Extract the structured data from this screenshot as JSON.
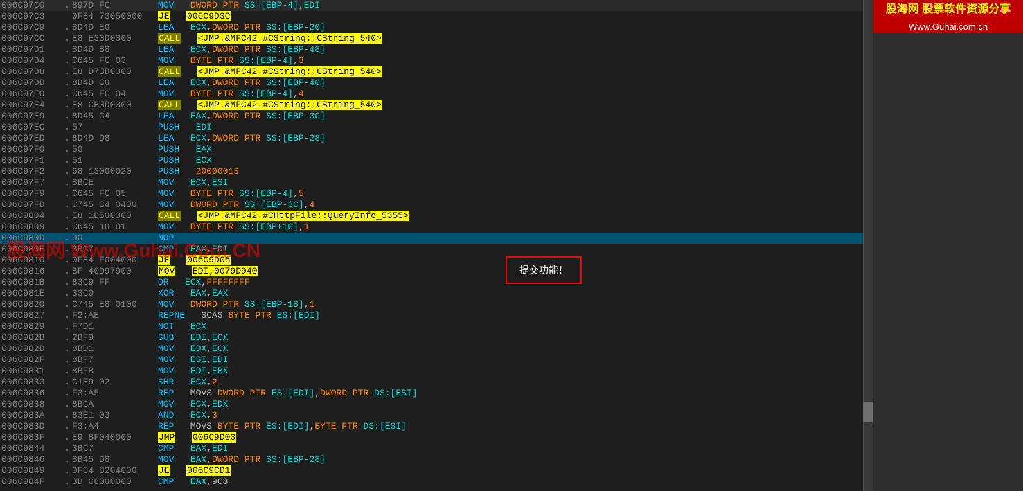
{
  "brand": {
    "name": "股海网 股票软件资源分享",
    "url": "Www.Guhai.com.cn"
  },
  "watermark": "股海网 Www.Guhai.Com.CN",
  "submit_box_text": "提交功能！",
  "rows": [
    {
      "address": "006C97C0",
      "dot": ".",
      "bytes": "897D FC",
      "mnemonic": "MOV",
      "operands": "DWORD PTR SS:[EBP-4],EDI",
      "highlight": "none"
    },
    {
      "address": "006C97C3",
      "dot": "",
      "bytes": "0F84 73050000",
      "mnemonic": "JE",
      "operands": "006C9D3C",
      "highlight": "je"
    },
    {
      "address": "006C97C9",
      "dot": ".",
      "bytes": "8D4D E0",
      "mnemonic": "LEA",
      "operands": "ECX,DWORD PTR SS:[EBP-20]",
      "highlight": "none"
    },
    {
      "address": "006C97CC",
      "dot": ".",
      "bytes": "E8 E33D0300",
      "mnemonic": "CALL",
      "operands": "<JMP.&MFC42.#CString::CString_540>",
      "highlight": "call"
    },
    {
      "address": "006C97D1",
      "dot": ".",
      "bytes": "8D4D B8",
      "mnemonic": "LEA",
      "operands": "ECX,DWORD PTR SS:[EBP-48]",
      "highlight": "none"
    },
    {
      "address": "006C97D4",
      "dot": ".",
      "bytes": "C645 FC 03",
      "mnemonic": "MOV",
      "operands": "BYTE PTR SS:[EBP-4],3",
      "highlight": "none"
    },
    {
      "address": "006C97D8",
      "dot": ".",
      "bytes": "E8 D73D0300",
      "mnemonic": "CALL",
      "operands": "<JMP.&MFC42.#CString::CString_540>",
      "highlight": "call"
    },
    {
      "address": "006C97DD",
      "dot": ".",
      "bytes": "8D4D C0",
      "mnemonic": "LEA",
      "operands": "ECX,DWORD PTR SS:[EBP-40]",
      "highlight": "none"
    },
    {
      "address": "006C97E0",
      "dot": ".",
      "bytes": "C645 FC 04",
      "mnemonic": "MOV",
      "operands": "BYTE PTR SS:[EBP-4],4",
      "highlight": "none"
    },
    {
      "address": "006C97E4",
      "dot": ".",
      "bytes": "E8 CB3D0300",
      "mnemonic": "CALL",
      "operands": "<JMP.&MFC42.#CString::CString_540>",
      "highlight": "call"
    },
    {
      "address": "006C97E9",
      "dot": ".",
      "bytes": "8D45 C4",
      "mnemonic": "LEA",
      "operands": "EAX,DWORD PTR SS:[EBP-3C]",
      "highlight": "none"
    },
    {
      "address": "006C97EC",
      "dot": ".",
      "bytes": "57",
      "mnemonic": "PUSH",
      "operands": "EDI",
      "highlight": "none"
    },
    {
      "address": "006C97ED",
      "dot": ".",
      "bytes": "8D4D D8",
      "mnemonic": "LEA",
      "operands": "ECX,DWORD PTR SS:[EBP-28]",
      "highlight": "none"
    },
    {
      "address": "006C97F0",
      "dot": ".",
      "bytes": "50",
      "mnemonic": "PUSH",
      "operands": "EAX",
      "highlight": "none"
    },
    {
      "address": "006C97F1",
      "dot": ".",
      "bytes": "51",
      "mnemonic": "PUSH",
      "operands": "ECX",
      "highlight": "none"
    },
    {
      "address": "006C97F2",
      "dot": ".",
      "bytes": "68 13000020",
      "mnemonic": "PUSH",
      "operands": "20000013",
      "highlight": "none"
    },
    {
      "address": "006C97F7",
      "dot": ".",
      "bytes": "8BCE",
      "mnemonic": "MOV",
      "operands": "ECX,ESI",
      "highlight": "none"
    },
    {
      "address": "006C97F9",
      "dot": ".",
      "bytes": "C645 FC 05",
      "mnemonic": "MOV",
      "operands": "BYTE PTR SS:[EBP-4],5",
      "highlight": "none"
    },
    {
      "address": "006C97FD",
      "dot": ".",
      "bytes": "C745 C4 0400",
      "mnemonic": "MOV",
      "operands": "DWORD PTR SS:[EBP-3C],4",
      "highlight": "none"
    },
    {
      "address": "006C9804",
      "dot": ".",
      "bytes": "E8 1D500300",
      "mnemonic": "CALL",
      "operands": "<JMP.&MFC42.#CHttpFile::QueryInfo_5355>",
      "highlight": "call"
    },
    {
      "address": "006C9809",
      "dot": ".",
      "bytes": "C645 10 01",
      "mnemonic": "MOV",
      "operands": "BYTE PTR SS:[EBP+10],1",
      "highlight": "none"
    },
    {
      "address": "006C980D",
      "dot": ".",
      "bytes": "90",
      "mnemonic": "NOP",
      "operands": "",
      "highlight": "nop"
    },
    {
      "address": "006C980E",
      "dot": ".",
      "bytes": "3BC7",
      "mnemonic": "CMP",
      "operands": "EAX,EDI",
      "highlight": "none"
    },
    {
      "address": "006C9810",
      "dot": ".",
      "bytes": "0F84 F004000",
      "mnemonic": "JE",
      "operands": "006C9D06",
      "highlight": "je"
    },
    {
      "address": "006C9816",
      "dot": ".",
      "bytes": "BF 40D97900",
      "mnemonic": "MOV",
      "operands": "EDI,0079D940",
      "highlight": "je"
    },
    {
      "address": "006C981B",
      "dot": ".",
      "bytes": "83C9 FF",
      "mnemonic": "OR",
      "operands": "ECX,FFFFFFFF",
      "highlight": "none"
    },
    {
      "address": "006C981E",
      "dot": ".",
      "bytes": "33C0",
      "mnemonic": "XOR",
      "operands": "EAX,EAX",
      "highlight": "none"
    },
    {
      "address": "006C9820",
      "dot": ".",
      "bytes": "C745 E8 0100",
      "mnemonic": "MOV",
      "operands": "DWORD PTR SS:[EBP-18],1",
      "highlight": "none"
    },
    {
      "address": "006C9827",
      "dot": ".",
      "bytes": "F2:AE",
      "mnemonic": "REPNE",
      "operands": "SCAS BYTE PTR ES:[EDI]",
      "highlight": "none"
    },
    {
      "address": "006C9829",
      "dot": ".",
      "bytes": "F7D1",
      "mnemonic": "NOT",
      "operands": "ECX",
      "highlight": "none"
    },
    {
      "address": "006C982B",
      "dot": ".",
      "bytes": "2BF9",
      "mnemonic": "SUB",
      "operands": "EDI,ECX",
      "highlight": "none"
    },
    {
      "address": "006C982D",
      "dot": ".",
      "bytes": "8BD1",
      "mnemonic": "MOV",
      "operands": "EDX,ECX",
      "highlight": "none"
    },
    {
      "address": "006C982F",
      "dot": ".",
      "bytes": "8BF7",
      "mnemonic": "MOV",
      "operands": "ESI,EDI",
      "highlight": "none"
    },
    {
      "address": "006C9831",
      "dot": ".",
      "bytes": "8BFB",
      "mnemonic": "MOV",
      "operands": "EDI,EBX",
      "highlight": "none"
    },
    {
      "address": "006C9833",
      "dot": ".",
      "bytes": "C1E9 02",
      "mnemonic": "SHR",
      "operands": "ECX,2",
      "highlight": "none"
    },
    {
      "address": "006C9836",
      "dot": ".",
      "bytes": "F3:A5",
      "mnemonic": "REP",
      "operands": "MOVS DWORD PTR ES:[EDI],DWORD PTR DS:[ESI]",
      "highlight": "none"
    },
    {
      "address": "006C9838",
      "dot": ".",
      "bytes": "8BCA",
      "mnemonic": "MOV",
      "operands": "ECX,EDX",
      "highlight": "none"
    },
    {
      "address": "006C983A",
      "dot": ".",
      "bytes": "83E1 03",
      "mnemonic": "AND",
      "operands": "ECX,3",
      "highlight": "none"
    },
    {
      "address": "006C983D",
      "dot": ".",
      "bytes": "F3:A4",
      "mnemonic": "REP",
      "operands": "MOVS BYTE PTR ES:[EDI],BYTE PTR DS:[ESI]",
      "highlight": "none"
    },
    {
      "address": "006C983F",
      "dot": ".",
      "bytes": "E9 BF040000",
      "mnemonic": "JMP",
      "operands": "006C9D03",
      "highlight": "jmp"
    },
    {
      "address": "006C9844",
      "dot": ".",
      "bytes": "3BC7",
      "mnemonic": "CMP",
      "operands": "EAX,EDI",
      "highlight": "none"
    },
    {
      "address": "006C9846",
      "dot": ".",
      "bytes": "8B45 D8",
      "mnemonic": "MOV",
      "operands": "EAX,DWORD PTR SS:[EBP-28]",
      "highlight": "none"
    },
    {
      "address": "006C9849",
      "dot": ".",
      "bytes": "0F84 8204000",
      "mnemonic": "JE",
      "operands": "006C9CD1",
      "highlight": "je"
    },
    {
      "address": "006C984F",
      "dot": ".",
      "bytes": "3D C8000000",
      "mnemonic": "CMP",
      "operands": "EAX,9C8",
      "highlight": "none"
    }
  ]
}
